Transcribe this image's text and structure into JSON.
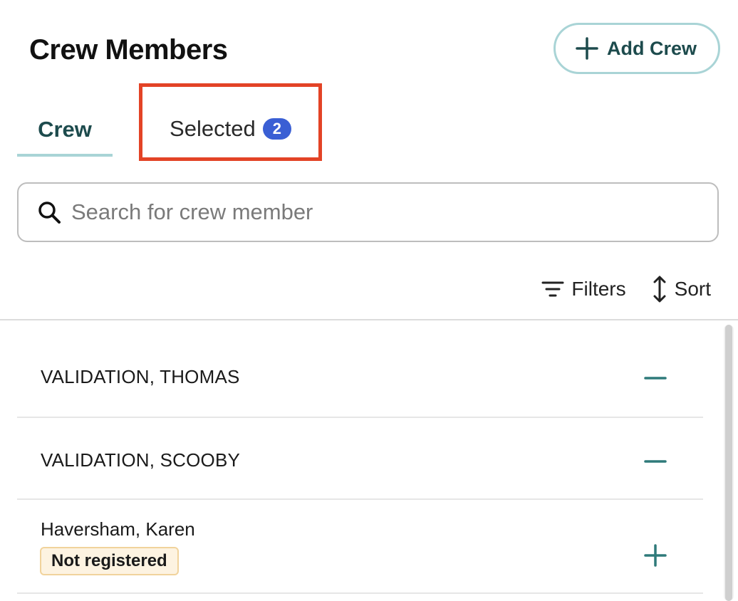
{
  "header": {
    "title": "Crew Members",
    "add_button_label": "Add Crew"
  },
  "tabs": [
    {
      "label": "Crew",
      "active": true
    },
    {
      "label": "Selected",
      "count": "2",
      "highlighted": true
    }
  ],
  "search": {
    "placeholder": "Search for crew member",
    "value": ""
  },
  "toolbar": {
    "filters_label": "Filters",
    "sort_label": "Sort"
  },
  "crew_list": [
    {
      "name": "VALIDATION, THOMAS",
      "action": "remove",
      "action_icon": "minus-icon"
    },
    {
      "name": "VALIDATION, SCOOBY",
      "action": "remove",
      "action_icon": "minus-icon"
    },
    {
      "name": "Haversham, Karen",
      "status": "Not registered",
      "action": "add",
      "action_icon": "plus-icon"
    }
  ],
  "colors": {
    "accent_teal": "#1d4b4d",
    "tab_underline": "#a9d4d6",
    "badge_blue": "#3a5fd4",
    "highlight_red": "#e34326",
    "status_bg": "#fdf3e1",
    "status_border": "#f1d39c"
  }
}
